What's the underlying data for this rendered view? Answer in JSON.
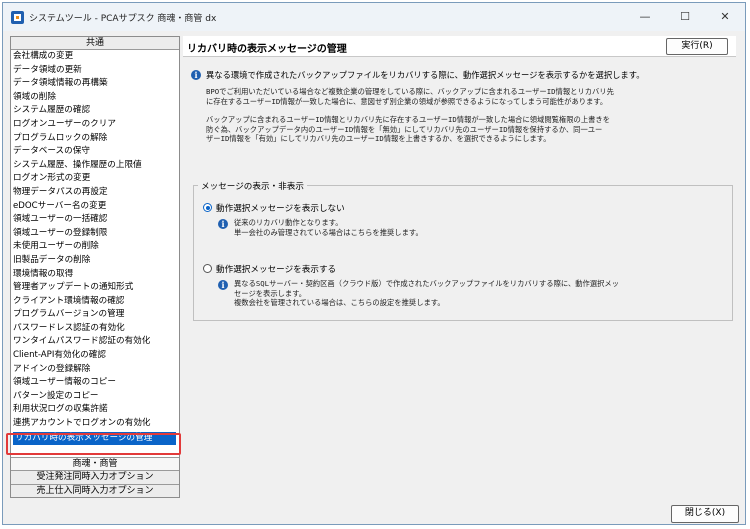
{
  "window": {
    "title": "システムツール - PCAサプスク 商魂・商管 dx",
    "minimize": "—",
    "maximize": "☐",
    "close": "✕"
  },
  "sidebar": {
    "header": "共通",
    "items": [
      "会社構成の変更",
      "データ領域の更新",
      "データ領域情報の再構築",
      "領域の削除",
      "システム履歴の確認",
      "ログオンユーザーのクリア",
      "プログラムロックの解除",
      "データベースの保守",
      "システム履歴、操作履歴の上限値",
      "ログオン形式の変更",
      "物理データパスの再設定",
      "eDOCサーバー名の変更",
      "領域ユーザーの一括確認",
      "領域ユーザーの登録制限",
      "未使用ユーザーの削除",
      "旧製品データの削除",
      "環境情報の取得",
      "管理者アップデートの通知形式",
      "クライアント環境情報の確認",
      "プログラムバージョンの管理",
      "パスワードレス認証の有効化",
      "ワンタイムパスワード認証の有効化",
      "Client-API有効化の確認",
      "アドインの登録解除",
      "領域ユーザー情報のコピー",
      "パターン設定のコピー",
      "利用状況ログの収集許諾",
      "連携アカウントでログオンの有効化"
    ],
    "selected": "リカバリ時の表示メッセージの管理",
    "groups": [
      "商魂・商管",
      "受注発注同時入力オプション",
      "売上仕入同時入力オプション"
    ]
  },
  "main": {
    "title": "リカバリ時の表示メッセージの管理",
    "exec_button": "実行(R)",
    "intro": "異なる環境で作成されたバックアップファイルをリカバリする際に、動作選択メッセージを表示するかを選択します。",
    "para1": [
      "BPOでご利用いただいている場合など複数企業の管理をしている際に、バックアップに含まれるユーザーID情報とリカバリ先",
      "に存在するユーザーID情報が一致した場合に、意図せず別企業の領域が参照できるようになってしまう可能性があります。"
    ],
    "para2": [
      "バックアップに含まれるユーザーID情報とリカバリ先に存在するユーザーID情報が一致した場合に領域閲覧権限の上書きを",
      "防ぐ為、バックアップデータ内のユーザーID情報を「無効」にしてリカバリ先のユーザーID情報を保持するか、同一ユー",
      "ザーID情報を「有効」にしてリカバリ先のユーザーID情報を上書きするか、を選択できるようにします。"
    ],
    "group_label": "メッセージの表示・非表示",
    "option1": {
      "label": "動作選択メッセージを表示しない",
      "desc": [
        "従来のリカバリ動作となります。",
        "単一会社のみ管理されている場合はこちらを推奨します。"
      ]
    },
    "option2": {
      "label": "動作選択メッセージを表示する",
      "desc": [
        "異なるSQLサーバー・契約区画（クラウド版）で作成されたバックアップファイルをリカバリする際に、動作選択メッ",
        "セージを表示します。",
        "複数会社を管理されている場合は、こちらの設定を推奨します。"
      ]
    }
  },
  "footer": {
    "close_button": "閉じる(X)"
  },
  "icons": {
    "info": "info-icon",
    "app": "app-icon"
  },
  "colors": {
    "accent": "#0a64c8",
    "highlight_box": "#e23a3a",
    "info": "#1f5fb0"
  }
}
